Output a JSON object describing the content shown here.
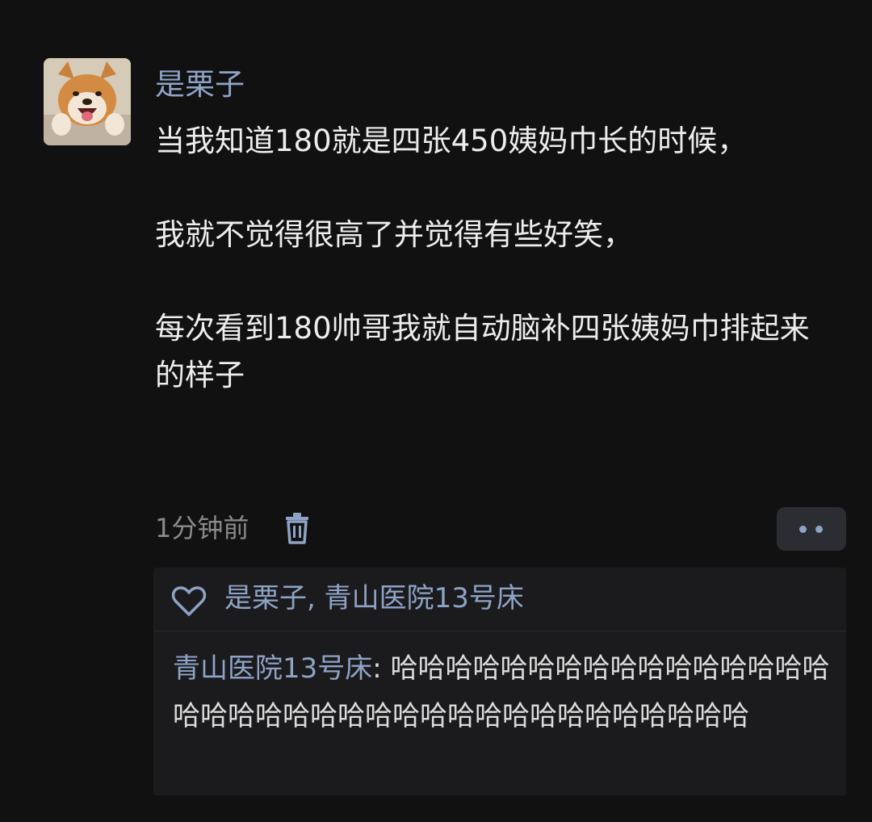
{
  "post": {
    "avatar_icon": "shiba-dog-avatar",
    "username": "是栗子",
    "text": "当我知道180就是四张450姨妈巾长的时候，\n\n我就不觉得很高了并觉得有些好笑，\n\n每次看到180帅哥我就自动脑补四张姨妈巾排起来的样子",
    "timestamp": "1分钟前",
    "delete_icon": "trash-icon",
    "more_icon": "more-dots-icon"
  },
  "interactions": {
    "like_icon": "heart-icon",
    "likers": "是栗子, 青山医院13号床",
    "comments": [
      {
        "author": "青山医院13号床",
        "separator": ": ",
        "text": "哈哈哈哈哈哈哈哈哈哈哈哈哈哈哈哈哈哈哈哈哈哈哈哈哈哈哈哈哈哈哈哈哈哈哈哈哈"
      }
    ]
  },
  "colors": {
    "background": "#111111",
    "link_blue": "#8fa3c6",
    "text": "#ededed",
    "muted": "#8a8a8a",
    "panel": "#1b1b1d"
  }
}
